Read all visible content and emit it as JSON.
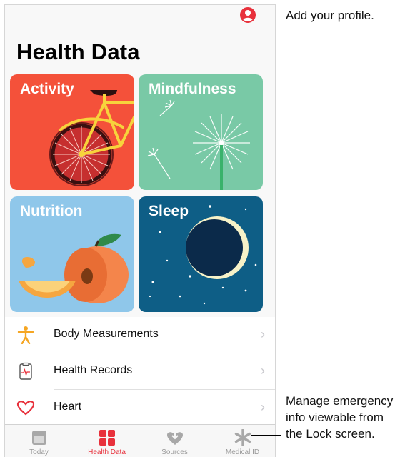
{
  "header": {
    "title": "Health Data"
  },
  "tiles": [
    {
      "label": "Activity",
      "color": "#f4513a"
    },
    {
      "label": "Mindfulness",
      "color": "#79c9a6"
    },
    {
      "label": "Nutrition",
      "color": "#8fc7ea"
    },
    {
      "label": "Sleep",
      "color": "#0e5e86"
    }
  ],
  "list": [
    {
      "label": "Body Measurements",
      "icon": "person-icon"
    },
    {
      "label": "Health Records",
      "icon": "clipboard-icon"
    },
    {
      "label": "Heart",
      "icon": "heart-icon"
    }
  ],
  "tabbar": {
    "tabs": [
      {
        "label": "Today",
        "icon": "calendar-icon"
      },
      {
        "label": "Health Data",
        "icon": "grid-icon"
      },
      {
        "label": "Sources",
        "icon": "heart-down-icon"
      },
      {
        "label": "Medical ID",
        "icon": "asterisk-icon"
      }
    ]
  },
  "callouts": {
    "profile": "Add your profile.",
    "medical_id_lines": [
      "Manage emergency",
      "info viewable from",
      "the Lock screen."
    ]
  },
  "colors": {
    "accent": "#e8313c"
  }
}
